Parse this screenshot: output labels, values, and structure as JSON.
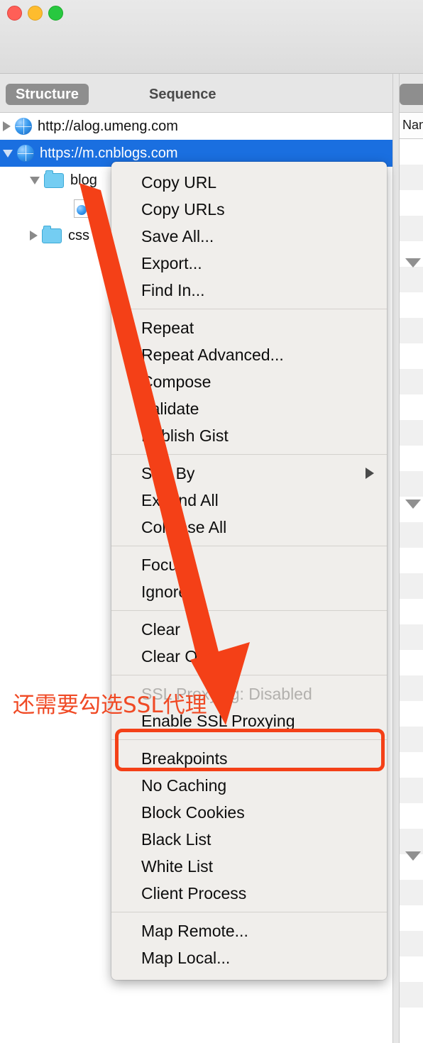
{
  "window": {
    "traffic_lights": [
      {
        "name": "close",
        "color": "#ff5f57"
      },
      {
        "name": "minimize",
        "color": "#febc2e"
      },
      {
        "name": "zoom",
        "color": "#28c840"
      }
    ]
  },
  "tabs": {
    "structure": "Structure",
    "sequence": "Sequence"
  },
  "right_panel": {
    "column_header": "Nam"
  },
  "tree": [
    {
      "label": "http://alog.umeng.com",
      "icon": "globe-icon",
      "disclosure": "right",
      "indent": 0,
      "selected": false
    },
    {
      "label": "https://m.cnblogs.com",
      "icon": "globe-icon",
      "disclosure": "down",
      "indent": 0,
      "selected": true
    },
    {
      "label": "blog",
      "icon": "folder-icon",
      "disclosure": "down",
      "indent": 1,
      "selected": false
    },
    {
      "label": "",
      "icon": "document-icon",
      "disclosure": "none",
      "indent": 2,
      "selected": false
    },
    {
      "label": "css",
      "icon": "folder-icon",
      "disclosure": "right",
      "indent": 1,
      "selected": false
    }
  ],
  "context_menu": {
    "groups": [
      {
        "items": [
          {
            "label": "Copy URL",
            "state": "normal"
          },
          {
            "label": "Copy URLs",
            "state": "normal"
          },
          {
            "label": "Save All...",
            "state": "normal"
          },
          {
            "label": "Export...",
            "state": "normal"
          },
          {
            "label": "Find In...",
            "state": "normal"
          }
        ]
      },
      {
        "items": [
          {
            "label": "Repeat",
            "state": "normal"
          },
          {
            "label": "Repeat Advanced...",
            "state": "normal"
          },
          {
            "label": "Compose",
            "state": "normal"
          },
          {
            "label": "Validate",
            "state": "normal"
          },
          {
            "label": "Publish Gist",
            "state": "normal"
          }
        ]
      },
      {
        "items": [
          {
            "label": "Sort By",
            "state": "normal",
            "submenu": true
          },
          {
            "label": "Expand All",
            "state": "normal"
          },
          {
            "label": "Collapse All",
            "state": "normal"
          }
        ]
      },
      {
        "items": [
          {
            "label": "Focus",
            "state": "normal"
          },
          {
            "label": "Ignore",
            "state": "normal"
          }
        ]
      },
      {
        "items": [
          {
            "label": "Clear",
            "state": "normal"
          },
          {
            "label": "Clear Others",
            "state": "normal"
          }
        ]
      },
      {
        "items": [
          {
            "label": "SSL Proxying: Disabled",
            "state": "disabled"
          },
          {
            "label": "Enable SSL Proxying",
            "state": "normal",
            "highlighted": true
          }
        ]
      },
      {
        "items": [
          {
            "label": "Breakpoints",
            "state": "normal"
          },
          {
            "label": "No Caching",
            "state": "normal"
          },
          {
            "label": "Block Cookies",
            "state": "normal"
          },
          {
            "label": "Black List",
            "state": "normal"
          },
          {
            "label": "White List",
            "state": "normal"
          },
          {
            "label": "Client Process",
            "state": "normal"
          }
        ]
      },
      {
        "items": [
          {
            "label": "Map Remote...",
            "state": "normal"
          },
          {
            "label": "Map Local...",
            "state": "normal"
          }
        ]
      }
    ]
  },
  "annotation": {
    "text": "还需要勾选SSL代理",
    "color": "#f04a25",
    "arrow_color": "#f44017",
    "highlight_color": "#f44017"
  }
}
